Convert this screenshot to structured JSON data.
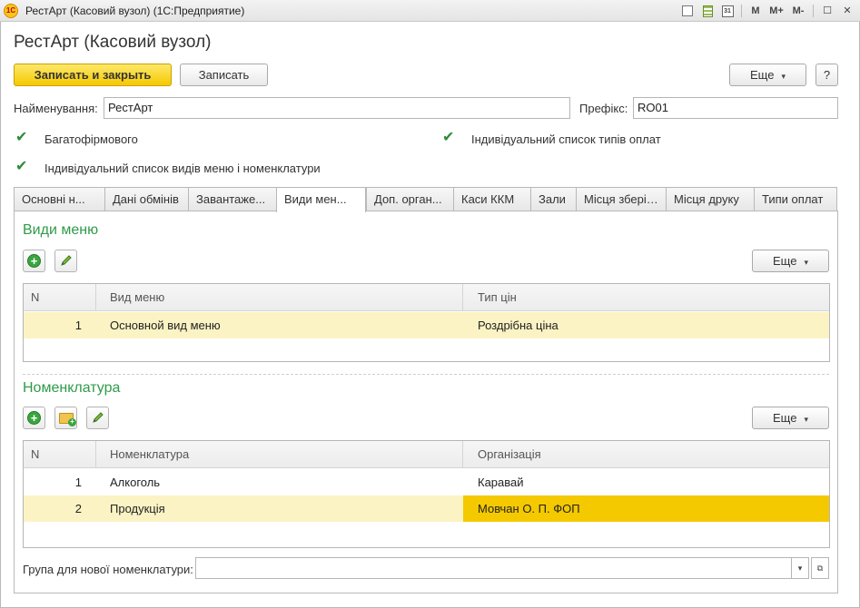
{
  "window": {
    "title": "РестАрт (Касовий вузол)  (1С:Предприятие)",
    "logo_text": "1С",
    "toolbar_letters": {
      "m": "M",
      "m_plus": "M+",
      "m_minus": "M-"
    }
  },
  "form": {
    "title": "РестАрт (Касовий вузол)",
    "save_close_label": "Записать и закрыть",
    "save_label": "Записать",
    "more_label": "Еще",
    "help_label": "?"
  },
  "fields": {
    "name_label": "Найменування:",
    "name_value": "РестАрт",
    "prefix_label": "Префікс:",
    "prefix_value": "RO01",
    "multi_firm_label": "Багатофірмового",
    "multi_firm_checked": true,
    "pay_types_label": "Індивідуальний список типів оплат",
    "pay_types_checked": true,
    "menu_types_label": "Індивідуальний список видів меню і номенклатури",
    "menu_types_checked": true
  },
  "tabs": [
    {
      "label": "Основні н..."
    },
    {
      "label": "Дані обмінів"
    },
    {
      "label": "Завантаже..."
    },
    {
      "label": "Види мен...",
      "active": true
    },
    {
      "label": "Доп. орган..."
    },
    {
      "label": "Каси ККМ"
    },
    {
      "label": "Зали"
    },
    {
      "label": "Місця зберіг..."
    },
    {
      "label": "Місця друку"
    },
    {
      "label": "Типи оплат"
    }
  ],
  "menu_section": {
    "title": "Види меню",
    "more_label": "Еще",
    "headers": {
      "n": "N",
      "col1": "Вид меню",
      "col2": "Тип цін"
    },
    "rows": [
      {
        "n": "1",
        "col1": "Основной вид меню",
        "col2": "Роздрібна ціна"
      }
    ]
  },
  "nom_section": {
    "title": "Номенклатура",
    "more_label": "Еще",
    "headers": {
      "n": "N",
      "col1": "Номенклатура",
      "col2": "Організація"
    },
    "rows": [
      {
        "n": "1",
        "col1": "Алкоголь",
        "col2": "Каравай"
      },
      {
        "n": "2",
        "col1": "Продукція",
        "col2": "Мовчан О. П. ФОП"
      }
    ]
  },
  "group_field": {
    "label": "Група для нової номенклатури:",
    "value": ""
  },
  "colors": {
    "accent_green": "#2e9b4a",
    "selected_row": "#fbf3c4",
    "current_cell": "#f5c900",
    "primary_button": "#f5c900"
  }
}
